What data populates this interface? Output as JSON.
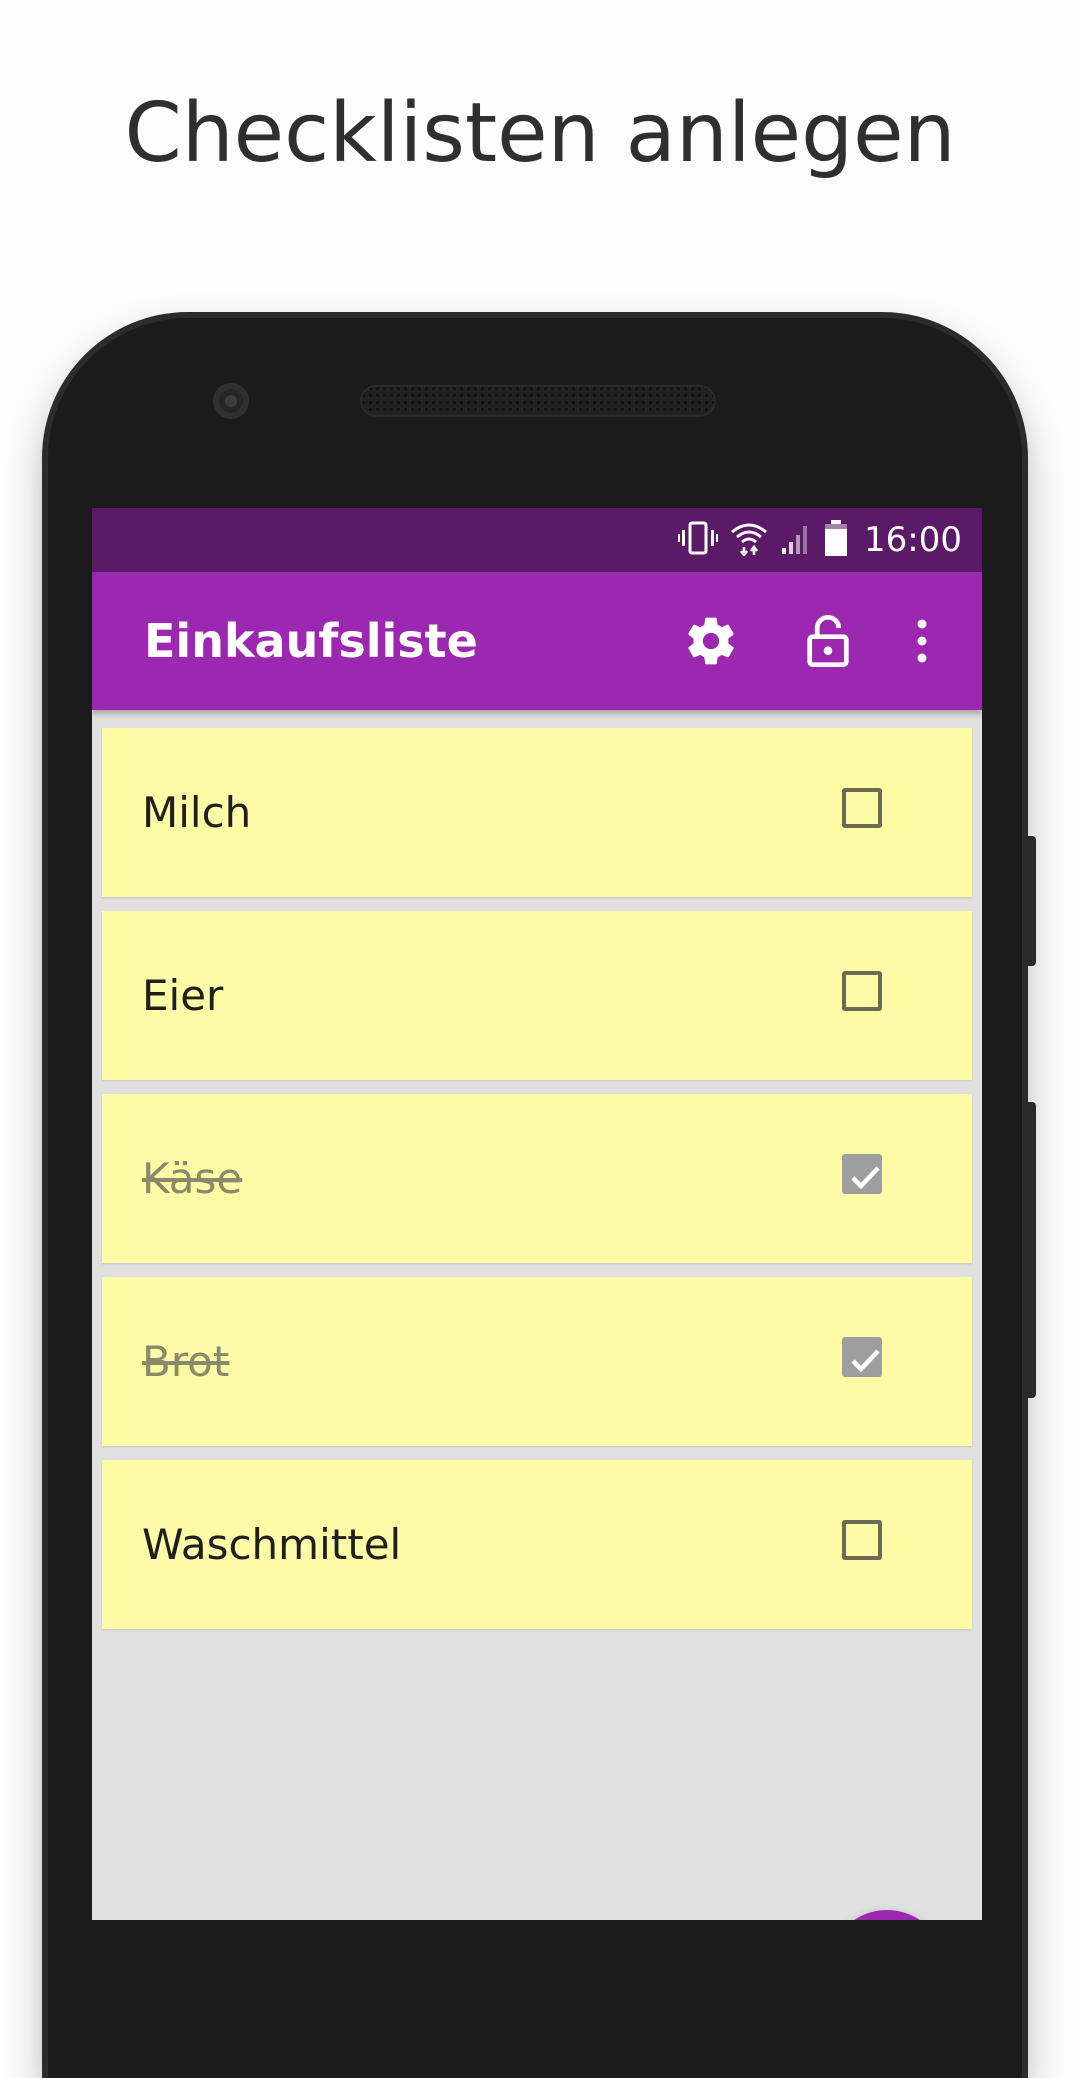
{
  "headline": "Checklisten anlegen",
  "status_bar": {
    "time": "16:00",
    "icons": [
      "vibrate-icon",
      "wifi-icon",
      "signal-icon",
      "battery-icon"
    ]
  },
  "app_bar": {
    "title": "Einkaufsliste",
    "actions": [
      "settings-icon",
      "unlock-icon",
      "more-vert-icon"
    ]
  },
  "checklist": {
    "items": [
      {
        "label": "Milch",
        "checked": false
      },
      {
        "label": "Eier",
        "checked": false
      },
      {
        "label": "Käse",
        "checked": true
      },
      {
        "label": "Brot",
        "checked": true
      },
      {
        "label": "Waschmittel",
        "checked": false
      }
    ]
  },
  "colors": {
    "primary": "#9c27b0",
    "primary_dark": "#5b1a67",
    "item_background": "#fdfba6",
    "list_background": "#e0e0e0"
  }
}
